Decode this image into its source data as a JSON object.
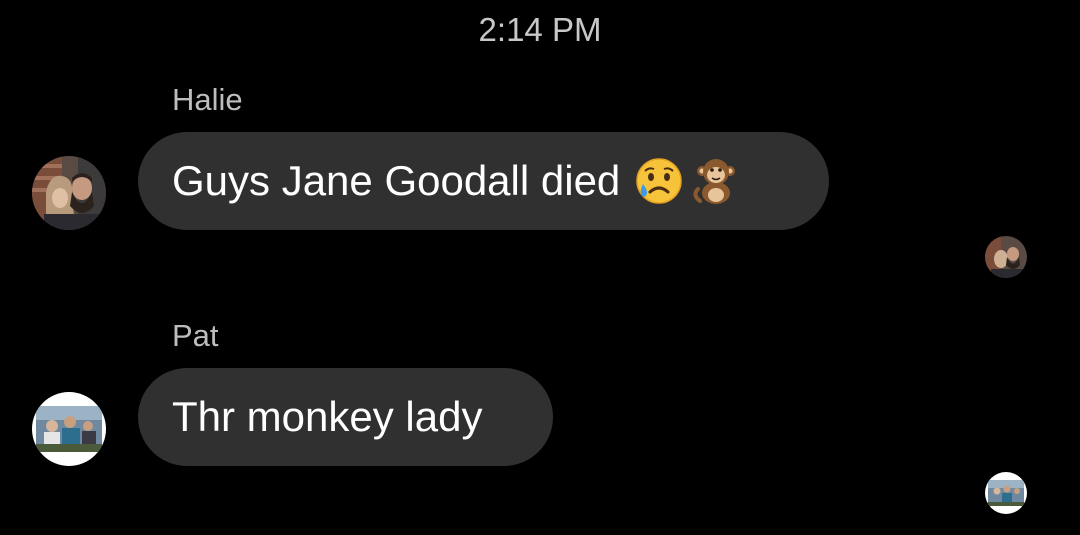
{
  "timestamp": "2:14 PM",
  "messages": [
    {
      "sender": "Halie",
      "text": "Guys Jane Goodall died",
      "emojis": [
        "sad-relieved-face-emoji",
        "monkey-emoji"
      ]
    },
    {
      "sender": "Pat",
      "text": "Thr monkey lady",
      "emojis": []
    }
  ],
  "colors": {
    "background": "#000000",
    "bubble": "#303030",
    "sender_name": "#bdbdbd",
    "timestamp": "#c8c8c8"
  }
}
